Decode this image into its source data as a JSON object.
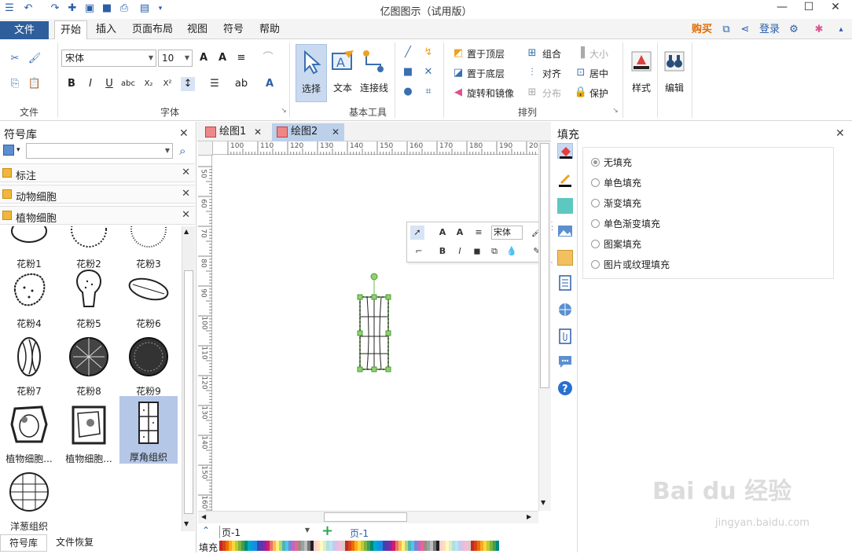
{
  "app": {
    "title": "亿图图示（试用版）",
    "window_controls": [
      "—",
      "☐",
      "✕"
    ]
  },
  "menu": {
    "file": "文件",
    "tabs": [
      "开始",
      "插入",
      "页面布局",
      "视图",
      "符号",
      "帮助"
    ],
    "active_tab": "开始",
    "buy": "购买",
    "login": "登录"
  },
  "ribbon": {
    "group_labels": {
      "file": "文件",
      "font": "字体",
      "basic_tools": "基本工具",
      "arrange": "排列"
    },
    "font_name": "宋体",
    "font_size": "10",
    "basic_tools": {
      "select": "选择",
      "text": "文本",
      "connector": "连接线"
    },
    "arrange": {
      "bring_to_front": "置于顶层",
      "send_to_back": "置于底层",
      "rotate_mirror": "旋转和镜像",
      "group": "组合",
      "align": "对齐",
      "distribute": "分布",
      "size": "大小",
      "center": "居中",
      "protect": "保护"
    },
    "style": "样式",
    "edit": "编辑"
  },
  "symbol_library": {
    "title": "符号库",
    "search_placeholder": "",
    "categories": [
      "标注",
      "动物细胞",
      "植物细胞"
    ],
    "shapes": [
      {
        "label": "花粉1"
      },
      {
        "label": "花粉2"
      },
      {
        "label": "花粉3"
      },
      {
        "label": "花粉4"
      },
      {
        "label": "花粉5"
      },
      {
        "label": "花粉6"
      },
      {
        "label": "花粉7"
      },
      {
        "label": "花粉8"
      },
      {
        "label": "花粉9"
      },
      {
        "label": "植物细胞..."
      },
      {
        "label": "植物细胞..."
      },
      {
        "label": "厚角组织"
      },
      {
        "label": "洋葱组织"
      }
    ],
    "selected_shape": "厚角组织",
    "bottom_tabs": [
      "符号库",
      "文件恢复"
    ]
  },
  "documents": {
    "tabs": [
      "绘图1",
      "绘图2"
    ],
    "active": "绘图2"
  },
  "ruler": {
    "top": [
      "100",
      "110",
      "120",
      "130",
      "140",
      "150",
      "160",
      "170",
      "180",
      "190",
      "20"
    ],
    "left": [
      "50",
      "60",
      "70",
      "80",
      "90",
      "100",
      "110",
      "120",
      "130",
      "140",
      "150",
      "160"
    ]
  },
  "floatbar": {
    "font": "宋体"
  },
  "pages": {
    "current": "页-1",
    "tabs": [
      "页-1"
    ],
    "fill_label": "填充"
  },
  "colors": {
    "accent": "#2e5f9c",
    "buy": "#e06b00",
    "login": "#2a5ea8",
    "selection_green": "#6abf4b"
  },
  "fill_panel": {
    "title": "填充",
    "options": [
      "无填充",
      "单色填充",
      "渐变填充",
      "单色渐变填充",
      "图案填充",
      "图片或纹理填充"
    ],
    "selected": "无填充"
  },
  "watermark": {
    "main": "Bai du 经验",
    "sub": "jingyan.baidu.com"
  }
}
